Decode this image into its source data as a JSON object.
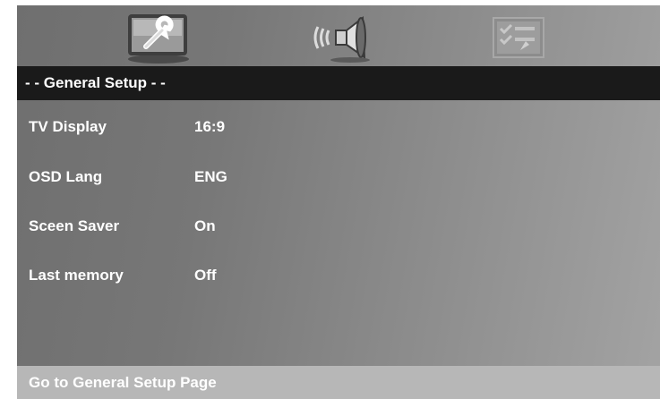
{
  "header": {
    "title": "- - General Setup - -"
  },
  "tabs": [
    {
      "icon": "wrench-icon",
      "label": "General Setup",
      "selected": true
    },
    {
      "icon": "speaker-icon",
      "label": "Audio Setup",
      "selected": false
    },
    {
      "icon": "checklist-icon",
      "label": "Preference Setup",
      "selected": false
    }
  ],
  "settings": [
    {
      "label": "TV Display",
      "value": "16:9"
    },
    {
      "label": "OSD Lang",
      "value": "ENG"
    },
    {
      "label": "Sceen Saver",
      "value": "On"
    },
    {
      "label": "Last memory",
      "value": "Off"
    }
  ],
  "status": {
    "text": "Go to General Setup Page"
  },
  "colors": {
    "header_bg": "#1a1a1a",
    "status_bg": "#b7b7b7",
    "text": "#ffffff"
  }
}
